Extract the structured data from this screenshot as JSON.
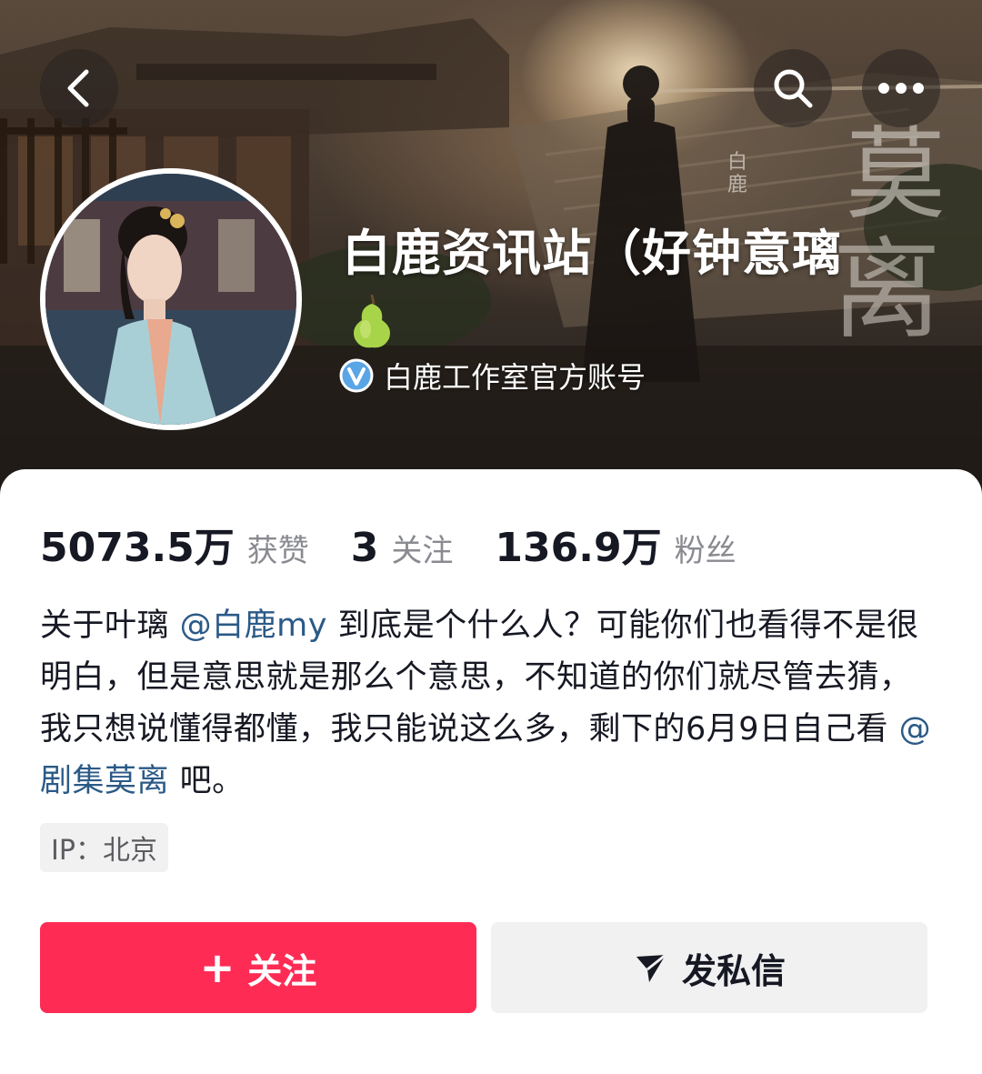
{
  "header": {
    "back_icon": "chevron-left-icon",
    "search_icon": "search-icon",
    "more_icon": "more-horizontal-icon"
  },
  "profile": {
    "name": "白鹿资讯站（好钟意璃",
    "badge_icon": "pear-emoji-icon",
    "verified_icon": "verified-v-icon",
    "verified_text": "白鹿工作室官方账号"
  },
  "stats": [
    {
      "value": "5073.5万",
      "label": "获赞"
    },
    {
      "value": "3",
      "label": "关注"
    },
    {
      "value": "136.9万",
      "label": "粉丝"
    }
  ],
  "bio": {
    "part1": "关于叶璃 ",
    "mention1": "@白鹿my",
    "part2": " 到底是个什么人？可能你们也看得不是很明白，但是意思就是那么个意思，不知道的你们就尽管去猜，我只想说懂得都懂，我只能说这么多，剩下的6月9日自己看 ",
    "mention2": "@剧集莫离",
    "part3": " 吧。"
  },
  "ip": "IP：北京",
  "actions": {
    "follow_label": "关注",
    "follow_icon": "plus-icon",
    "message_label": "发私信",
    "message_icon": "paper-plane-icon"
  },
  "colors": {
    "primary": "#fe2c55",
    "mention": "#2b5a87",
    "secondary_button": "#f1f1f2",
    "text": "#161823",
    "muted_text": "#8a8b91"
  }
}
